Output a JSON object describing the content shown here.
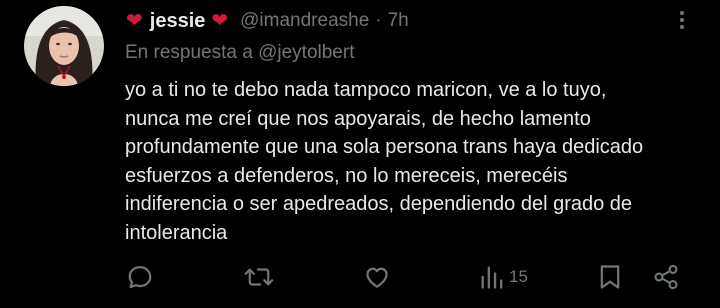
{
  "tweet": {
    "author": {
      "display_name": "jessie",
      "name_emoji": "❤",
      "handle": "@imandreashe",
      "avatar_icon": "avatar-photo"
    },
    "separator": "·",
    "time": "7h",
    "reply_prefix": "En respuesta a",
    "reply_to": "@jeytolbert",
    "text_lines": [
      "yo a ti no te debo nada tampoco maricon, ve a lo tuyo,",
      "nunca me creí que nos apoyarais, de hecho lamento",
      "profundamente que una sola persona trans haya dedicado",
      "esfuerzos a defenderos, no lo mereceis, merecéis",
      "indiferencia o ser apedreados, dependiendo del grado de",
      "intolerancia"
    ]
  },
  "actions": {
    "reply_icon": "reply-icon",
    "repost_icon": "repost-icon",
    "like_icon": "like-icon",
    "views_icon": "views-icon",
    "views_count": "15",
    "bookmark_icon": "bookmark-icon",
    "share_icon": "share-icon"
  },
  "colors": {
    "background": "#000000",
    "primary_text": "#e7e9ea",
    "secondary_text": "#71767b",
    "heart": "#d01b3a"
  }
}
